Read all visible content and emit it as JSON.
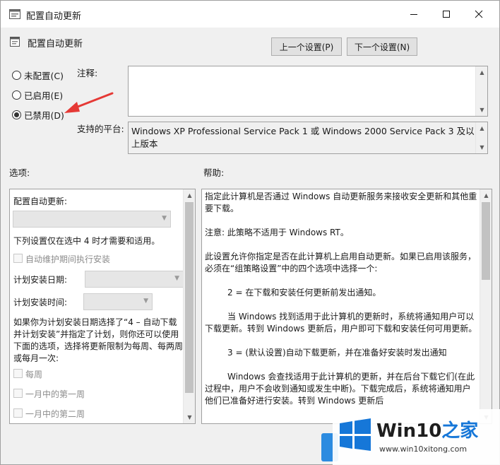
{
  "window": {
    "title": "配置自动更新",
    "controls": {
      "minimize": "minimize",
      "maximize": "maximize",
      "close": "close"
    }
  },
  "header": {
    "policy_title": "配置自动更新"
  },
  "nav": {
    "prev_label": "上一个设置(P)",
    "next_label": "下一个设置(N)"
  },
  "state": {
    "options": [
      {
        "label": "未配置(C)",
        "checked": false
      },
      {
        "label": "已启用(E)",
        "checked": false
      },
      {
        "label": "已禁用(D)",
        "checked": true
      }
    ]
  },
  "comment": {
    "label": "注释:",
    "value": ""
  },
  "platform": {
    "label": "支持的平台:",
    "value": "Windows XP Professional Service Pack 1 或 Windows 2000 Service Pack 3 及以上版本"
  },
  "options_section": {
    "label": "选项:",
    "config_label": "配置自动更新:",
    "note": "下列设置仅在选中 4 时才需要和适用。",
    "maint_checkbox": "自动维护期间执行安装",
    "schedule_day_label": "计划安装日期:",
    "schedule_time_label": "计划安装时间:",
    "schedule_para": "如果你为计划安装日期选择了“4 – 自动下载并计划安装”并指定了计划，则你还可以使用下面的选项，选择将更新限制为每周、每两周或每月一次:",
    "weekly": "每周",
    "first_week": "一月中的第一周",
    "second_week": "一月中的第二周"
  },
  "help_section": {
    "label": "帮助:",
    "paragraphs": [
      "指定此计算机是否通过 Windows 自动更新服务来接收安全更新和其他重要下载。",
      "注意: 此策略不适用于 Windows RT。",
      "此设置允许你指定是否在此计算机上启用自动更新。如果已启用该服务，必须在“组策略设置”中的四个选项中选择一个:",
      "2 = 在下载和安装任何更新前发出通知。",
      "当 Windows 找到适用于此计算机的更新时，系统将通知用户可以下载更新。转到 Windows 更新后，用户即可下载和安装任何可用更新。",
      "3 = (默认设置)自动下载更新，并在准备好安装时发出通知",
      "Windows 会查找适用于此计算机的更新，并在后台下载它们(在此过程中，用户不会收到通知或发生中断)。下载完成后，系统将通知用户他们已准备好进行安装。转到 Windows 更新后"
    ]
  },
  "watermark": {
    "brand_prefix": "Win10",
    "brand_suffix": "之家",
    "url": "www.win10xitong.com"
  },
  "colors": {
    "annotation_arrow": "#e53935",
    "watermark_blue": "#1677d8"
  }
}
